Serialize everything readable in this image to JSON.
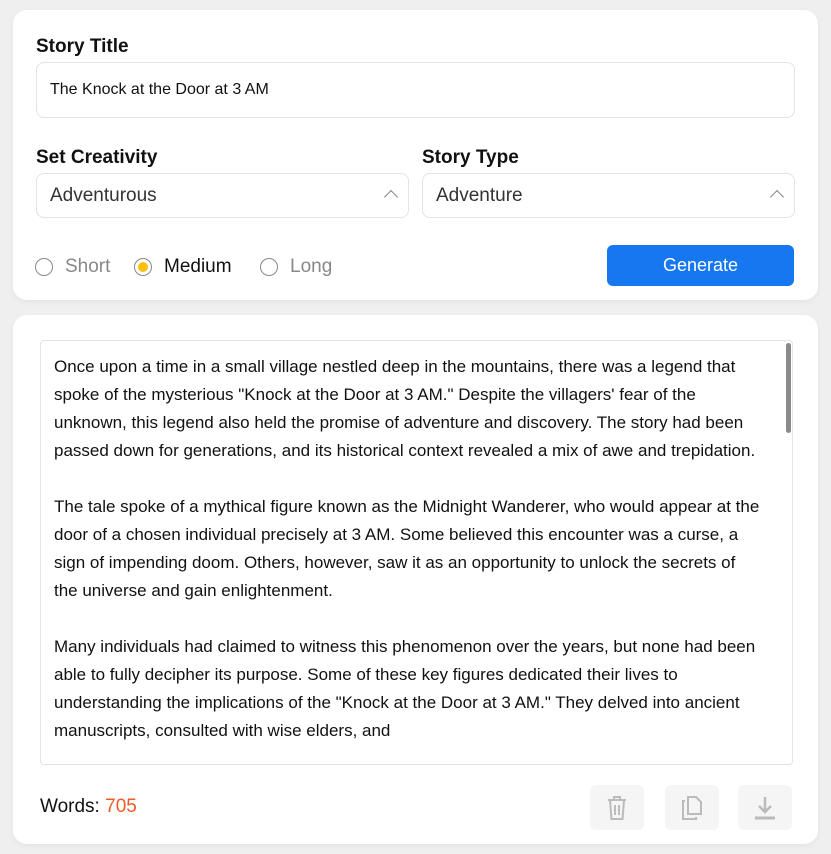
{
  "form": {
    "title_label": "Story Title",
    "title_value": "The Knock at the Door at 3 AM",
    "creativity_label": "Set Creativity",
    "creativity_value": "Adventurous",
    "type_label": "Story Type",
    "type_value": "Adventure",
    "lengths": [
      {
        "label": "Short",
        "selected": false
      },
      {
        "label": "Medium",
        "selected": true
      },
      {
        "label": "Long",
        "selected": false
      }
    ],
    "generate_label": "Generate",
    "accent": "#1677f0",
    "radio_color": "#fbbf10"
  },
  "output": {
    "paragraphs": [
      "Once upon a time in a small village nestled deep in the mountains, there was a legend that spoke of the mysterious \"Knock at the Door at 3 AM.\" Despite the villagers' fear of the unknown, this legend also held the promise of adventure and discovery. The story had been passed down for generations, and its historical context revealed a mix of awe and trepidation.",
      "The tale spoke of a mythical figure known as the Midnight Wanderer, who would appear at the door of a chosen individual precisely at 3 AM. Some believed this encounter was a curse, a sign of impending doom. Others, however, saw it as an opportunity to unlock the secrets of the universe and gain enlightenment.",
      "Many individuals had claimed to witness this phenomenon over the years, but none had been able to fully decipher its purpose. Some of these key figures dedicated their lives to understanding the implications of the \"Knock at the Door at 3 AM.\" They delved into ancient manuscripts, consulted with wise elders, and"
    ],
    "words_label": "Words:",
    "word_count": "705",
    "icons": [
      "trash-icon",
      "copy-icon",
      "download-icon"
    ]
  }
}
